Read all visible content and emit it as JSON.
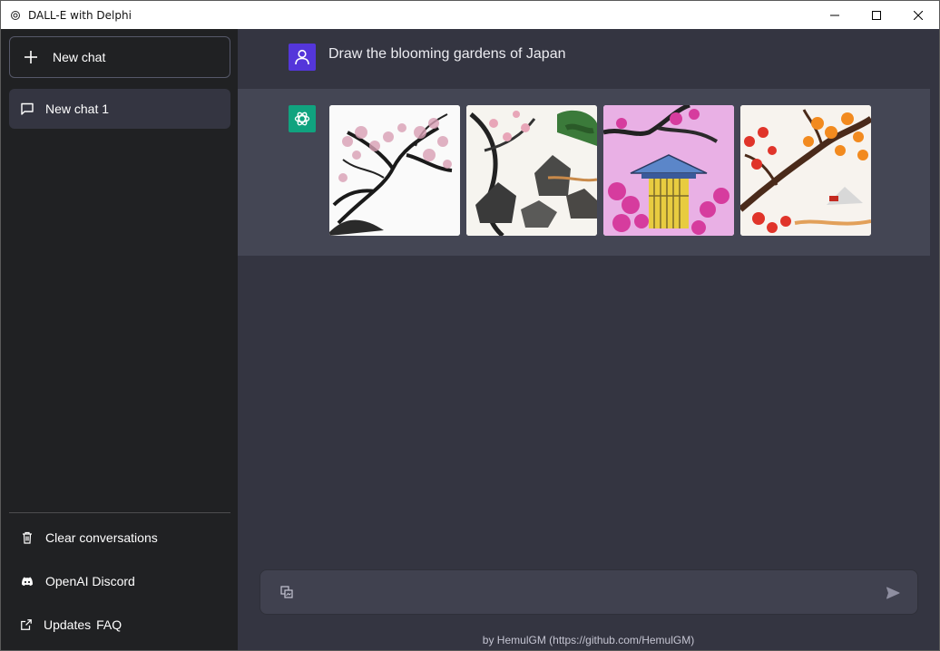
{
  "window": {
    "title": "DALL-E with Delphi"
  },
  "sidebar": {
    "new_chat_label": "New chat",
    "chats": [
      {
        "label": "New chat 1"
      }
    ],
    "links": {
      "clear": "Clear conversations",
      "discord": "OpenAI Discord",
      "updates": "Updates",
      "faq": "FAQ"
    }
  },
  "conversation": {
    "user_message": "Draw the blooming gardens of Japan",
    "ai_images": [
      {
        "icon": "sakura-ink-image"
      },
      {
        "icon": "rock-garden-image"
      },
      {
        "icon": "pink-pagoda-image"
      },
      {
        "icon": "orange-blossom-image"
      }
    ]
  },
  "input": {
    "value": "",
    "placeholder": ""
  },
  "footer": {
    "credit": "by HemulGM (https://github.com/HemulGM)"
  },
  "colors": {
    "sidebar": "#202123",
    "main": "#343541",
    "ai_row": "#444654",
    "user_avatar": "#5436da",
    "ai_avatar": "#10a37f"
  }
}
